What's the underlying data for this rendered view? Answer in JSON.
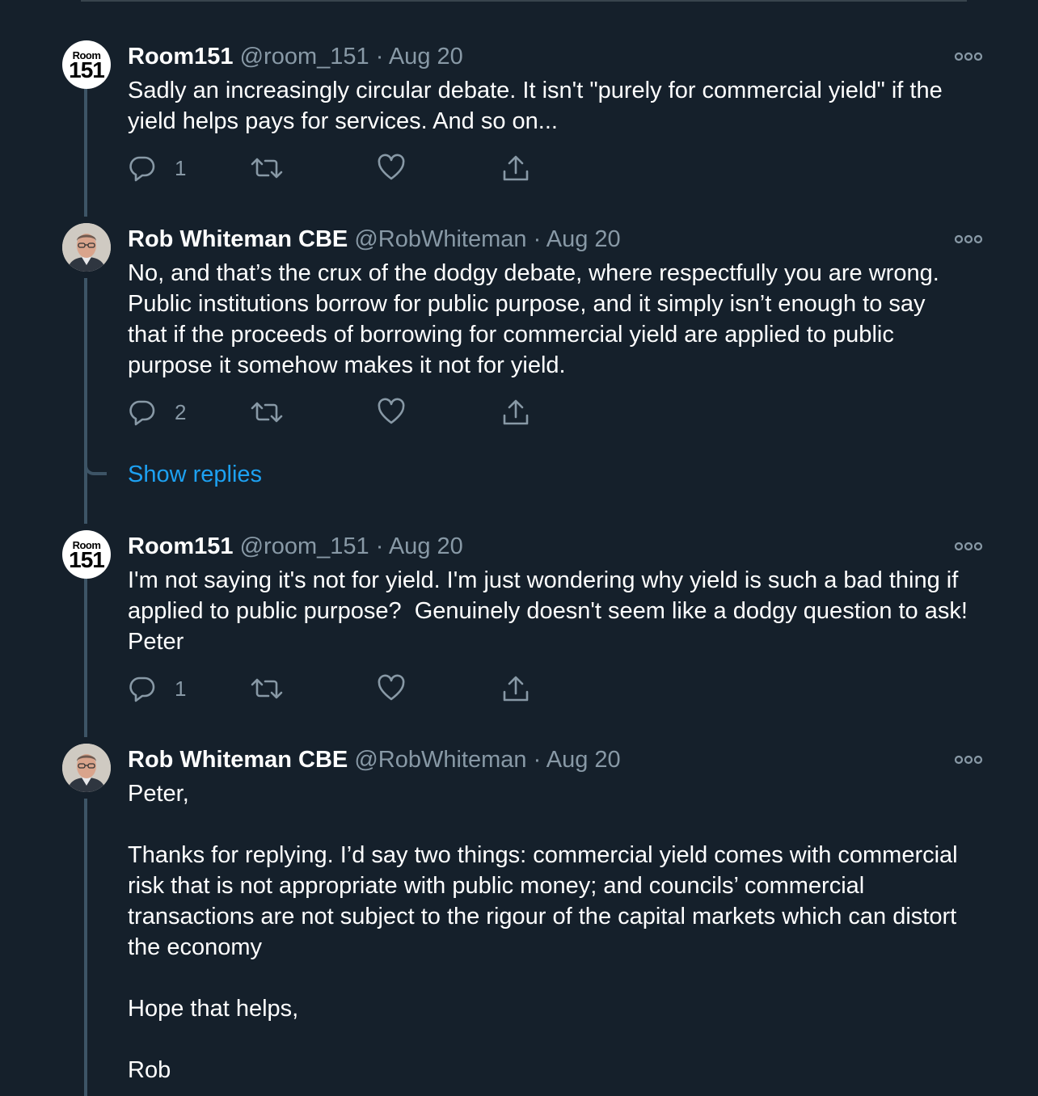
{
  "tweets": [
    {
      "name": "Room151",
      "handle": "@room_151",
      "dot": "·",
      "date": "Aug 20",
      "text": "Sadly an increasingly circular debate. It isn't \"purely for commercial yield\" if the yield helps pays for services. And so on...",
      "reply_count": "1",
      "avatar_small": "Room",
      "avatar_big": "151"
    },
    {
      "name": "Rob Whiteman CBE",
      "handle": "@RobWhiteman",
      "dot": "·",
      "date": "Aug 20",
      "text": "No, and that’s the crux of the dodgy debate, where respectfully you are wrong. Public institutions borrow for public purpose, and it simply isn’t enough to say that if the proceeds of borrowing for commercial yield are applied to public purpose it somehow makes it not for yield.",
      "reply_count": "2"
    },
    {
      "name": "Room151",
      "handle": "@room_151",
      "dot": "·",
      "date": "Aug 20",
      "text": "I'm not saying it's not for yield. I'm just wondering why yield is such a bad thing if applied to public purpose?  Genuinely doesn't seem like a dodgy question to ask! Peter",
      "reply_count": "1",
      "avatar_small": "Room",
      "avatar_big": "151"
    },
    {
      "name": "Rob Whiteman CBE",
      "handle": "@RobWhiteman",
      "dot": "·",
      "date": "Aug 20",
      "text": "Peter,\n\nThanks for replying. I’d say two things: commercial yield comes with commercial risk that is not appropriate with public money; and councils’ commercial transactions are not subject to the rigour of the capital markets which can distort the economy\n\nHope that helps,\n\nRob"
    }
  ],
  "show_replies_label": "Show replies",
  "colors": {
    "background": "#15202b",
    "secondary_text": "#8899a6",
    "link": "#1da1f2",
    "thread_line": "#3d5466"
  },
  "icons": [
    "reply-icon",
    "retweet-icon",
    "like-icon",
    "share-icon",
    "more-icon"
  ]
}
